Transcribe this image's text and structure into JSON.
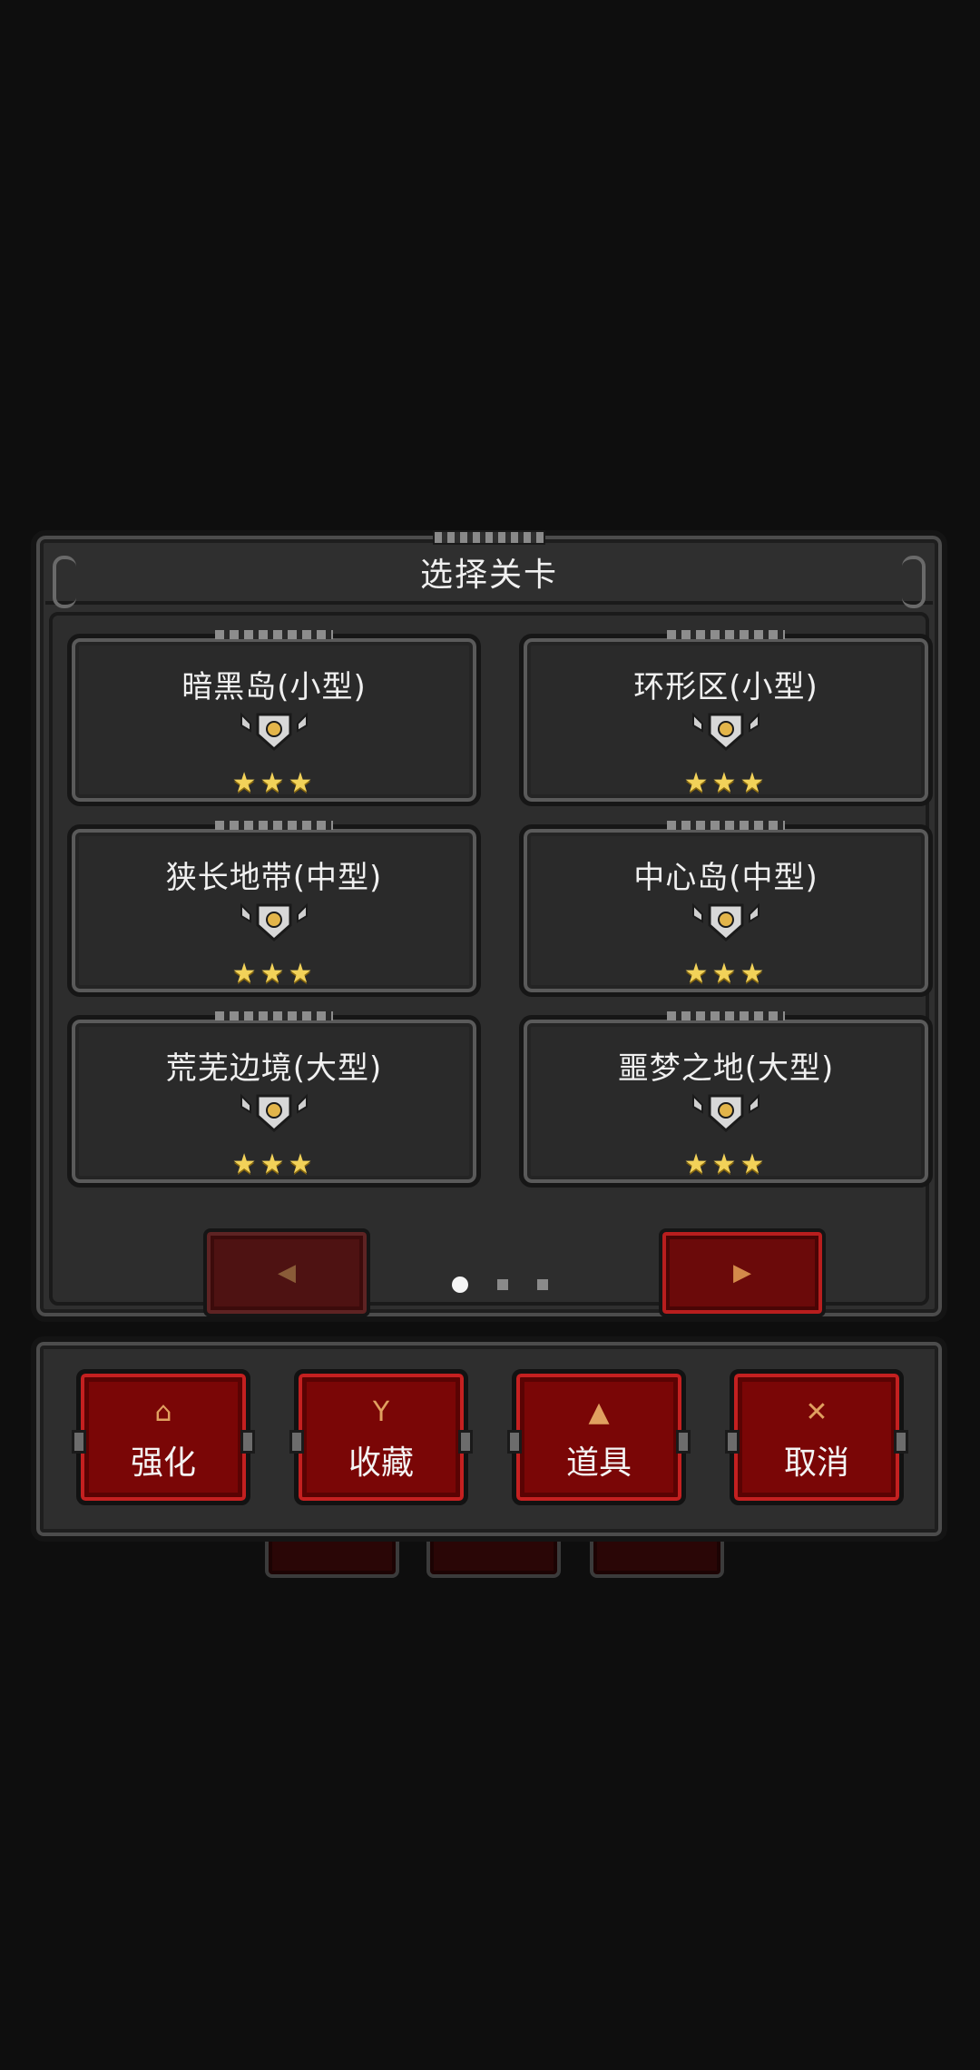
{
  "dialog": {
    "title": "选择关卡"
  },
  "levels": [
    {
      "name": "暗黑岛(小型)",
      "stars": "★★★"
    },
    {
      "name": "环形区(小型)",
      "stars": "★★★"
    },
    {
      "name": "狭长地带(中型)",
      "stars": "★★★"
    },
    {
      "name": "中心岛(中型)",
      "stars": "★★★"
    },
    {
      "name": "荒芜边境(大型)",
      "stars": "★★★"
    },
    {
      "name": "噩梦之地(大型)",
      "stars": "★★★"
    }
  ],
  "pager": {
    "prev_icon": "◀",
    "next_icon": "▶",
    "current_page": 1,
    "total_pages": 3
  },
  "actions": [
    {
      "label": "强化",
      "icon": "upgrade-icon",
      "glyph": "⌂"
    },
    {
      "label": "收藏",
      "icon": "goblet-icon",
      "glyph": "Y"
    },
    {
      "label": "道具",
      "icon": "potion-icon",
      "glyph": "▲"
    },
    {
      "label": "取消",
      "icon": "close-icon",
      "glyph": "✕"
    }
  ],
  "colors": {
    "panel": "#2f2f2f",
    "button_red": "#7a0606",
    "star_gold": "#f2d259"
  }
}
